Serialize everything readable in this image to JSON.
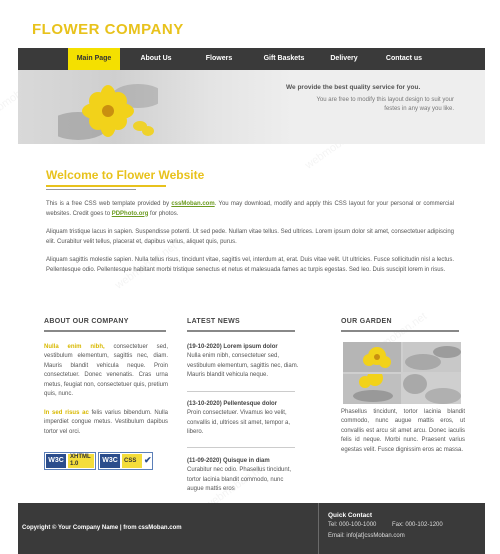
{
  "header": {
    "logo": "FLOWER COMPANY"
  },
  "nav": {
    "items": [
      {
        "label": "Main Page",
        "active": true
      },
      {
        "label": "About Us",
        "active": false
      },
      {
        "label": "Flowers",
        "active": false
      },
      {
        "label": "Gift Baskets",
        "active": false
      },
      {
        "label": "Delivery",
        "active": false
      },
      {
        "label": "Contact us",
        "active": false
      }
    ]
  },
  "hero": {
    "title": "We provide the best quality service for you.",
    "subtitle": "You are free to modify this layout design to suit your festes in any way you like."
  },
  "welcome": {
    "title": "Welcome to Flower Website",
    "p1_a": "This is a free CSS web template provided by ",
    "p1_link1": "cssMoban.com",
    "p1_b": ". You may download, modify and apply this CSS layout for your personal or commercial websites. Credit goes to ",
    "p1_link2": "PDPhoto.org",
    "p1_c": " for photos.",
    "p2": "Aliquam tristique lacus in sapien. Suspendisse potenti. Ut sed pede. Nullam vitae tellus. Sed ultrices. Lorem ipsum dolor sit amet, consectetuer adipiscing elit. Curabitur velit tellus, placerat et, dapibus varius, aliquet quis, purus.",
    "p3": "Aliquam sagittis molestie sapien. Nulla tellus risus, tincidunt vitae, sagittis vel, interdum at, erat. Duis vitae velit. Ut ultricies. Fusce sollicitudin nisl a lectus. Pellentesque odio. Pellentesque habitant morbi tristique senectus et netus et malesuada fames ac turpis egestas. Sed leo. Duis suscipit lorem in risus."
  },
  "about": {
    "title": "ABOUT OUR COMPANY",
    "hl1": "Nulla enim nibh,",
    "t1": " consectetuer sed, vestibulum elementum, sagittis nec, diam. Mauris blandit vehicula neque. Proin consectetuer. Donec venenatis. Cras urna metus, feugiat non, consectetuer quis, pretium quis, nunc.",
    "hl2": "In sed risus ac",
    "t2": " felis varius bibendum. Nulla imperdiet congue metus. Vestibulum dapibus tortor vel orci."
  },
  "news": {
    "title": "LATEST NEWS",
    "items": [
      {
        "date": "(19-10-2020) Lorem ipsum dolor",
        "text": "Nulla enim nibh, consectetuer sed, vestibulum elementum, sagittis nec, diam. Mauris blandit vehicula neque."
      },
      {
        "date": "(13-10-2020) Pellentesque dolor",
        "text": "Proin consectetuer. Vivamus leo velit, convallis id, ultrices sit amet, tempor a, libero."
      },
      {
        "date": "(11-09-2020) Quisque in diam",
        "text": "Curabitur nec odio. Phasellus tincidunt, tortor lacinia blandit commodo, nunc augue mattis eros"
      }
    ]
  },
  "garden": {
    "title": "OUR GARDEN",
    "text": "Phasellus tincidunt, tortor lacinia blandit commodo, nunc augue mattis eros, ut convallis est arcu sit amet arcu. Donec iaculis felis id neque. Morbi nunc. Praesent varius egestas velit. Fusce dignissim eros ac massa."
  },
  "badges": [
    {
      "w3": "W3C",
      "kind": "XHTML 1.0"
    },
    {
      "w3": "W3C",
      "kind": "CSS"
    }
  ],
  "footer": {
    "copyright": "Copyright © Your Company Name | from cssMoban.com",
    "contact_title": "Quick Contact",
    "tel": "Tel: 000-100-1000",
    "fax": "Fax: 000-102-1200",
    "email": "Email: info[at]cssMoban.com"
  },
  "watermark": "webmoban.net",
  "colors": {
    "accent": "#e8c21c",
    "nav_bg": "#3a3a3a",
    "active_tab": "#f4e000",
    "link_green": "#6b9a1f"
  }
}
